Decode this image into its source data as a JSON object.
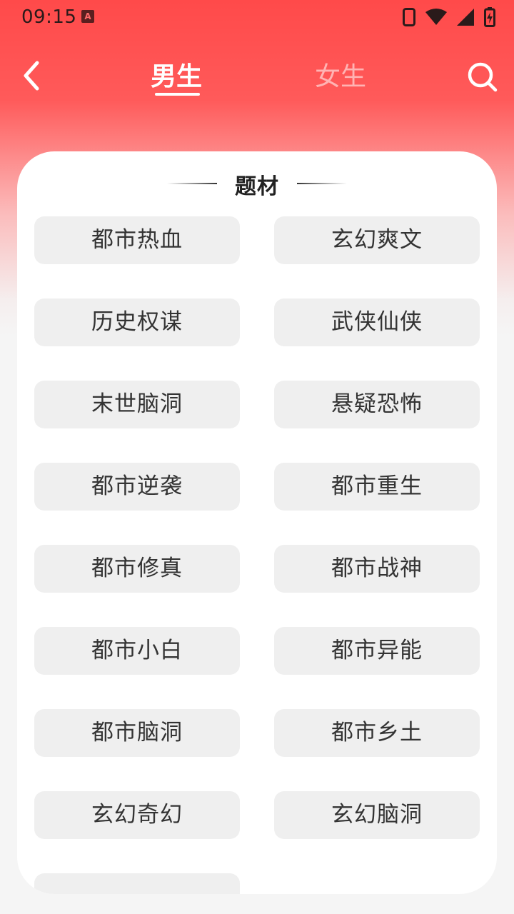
{
  "status_bar": {
    "time": "09:15",
    "app_icon_letter": "A",
    "icons": [
      "phone-icon",
      "wifi-icon",
      "signal-icon",
      "battery-charging-icon"
    ]
  },
  "nav": {
    "tabs": [
      {
        "label": "男生",
        "active": true
      },
      {
        "label": "女生",
        "active": false
      }
    ]
  },
  "section": {
    "title": "题材",
    "tags": [
      "都市热血",
      "玄幻爽文",
      "历史权谋",
      "武侠仙侠",
      "末世脑洞",
      "悬疑恐怖",
      "都市逆袭",
      "都市重生",
      "都市修真",
      "都市战神",
      "都市小白",
      "都市异能",
      "都市脑洞",
      "都市乡土",
      "玄幻奇幻",
      "玄幻脑洞"
    ]
  },
  "colors": {
    "header_red": "#ff4a4a",
    "tag_bg": "#efefef",
    "text_dark": "#333333"
  }
}
